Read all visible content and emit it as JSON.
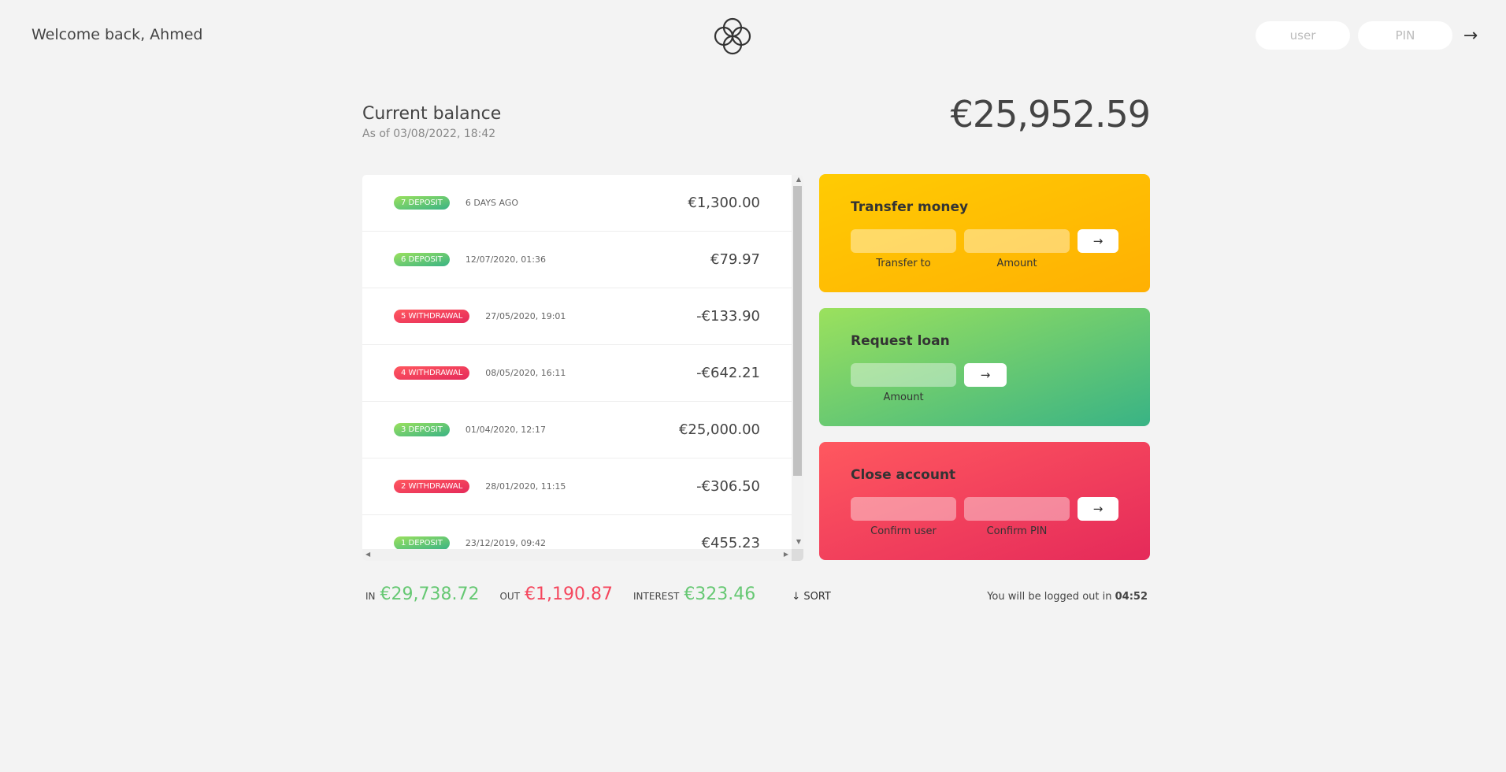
{
  "nav": {
    "welcome": "Welcome back, Ahmed",
    "user_placeholder": "user",
    "pin_placeholder": "PIN",
    "login_arrow": "→"
  },
  "balance": {
    "label": "Current balance",
    "date": "As of 03/08/2022, 18:42",
    "value": "€25,952.59"
  },
  "movements": [
    {
      "badge": "7 deposit",
      "type": "deposit",
      "date": "6 days ago",
      "value": "€1,300.00"
    },
    {
      "badge": "6 deposit",
      "type": "deposit",
      "date": "12/07/2020, 01:36",
      "value": "€79.97"
    },
    {
      "badge": "5 withdrawal",
      "type": "withdrawal",
      "date": "27/05/2020, 19:01",
      "value": "-€133.90"
    },
    {
      "badge": "4 withdrawal",
      "type": "withdrawal",
      "date": "08/05/2020, 16:11",
      "value": "-€642.21"
    },
    {
      "badge": "3 deposit",
      "type": "deposit",
      "date": "01/04/2020, 12:17",
      "value": "€25,000.00"
    },
    {
      "badge": "2 withdrawal",
      "type": "withdrawal",
      "date": "28/01/2020, 11:15",
      "value": "-€306.50"
    },
    {
      "badge": "1 deposit",
      "type": "deposit",
      "date": "23/12/2019, 09:42",
      "value": "€455.23"
    }
  ],
  "operations": {
    "transfer": {
      "title": "Transfer money",
      "label_to": "Transfer to",
      "label_amount": "Amount",
      "button": "→"
    },
    "loan": {
      "title": "Request loan",
      "label_amount": "Amount",
      "button": "→"
    },
    "close": {
      "title": "Close account",
      "label_user": "Confirm user",
      "label_pin": "Confirm PIN",
      "button": "→"
    }
  },
  "summary": {
    "in_label": "In",
    "in_value": "€29,738.72",
    "out_label": "Out",
    "out_value": "€1,190.87",
    "interest_label": "Interest",
    "interest_value": "€323.46",
    "sort": "↓ SORT"
  },
  "timer": {
    "text": "You will be logged out in",
    "time": "04:52"
  },
  "colors": {
    "deposit": "#66c873",
    "withdrawal": "#f5465d",
    "transfer": "#ffb003",
    "loan": "#39b385",
    "close": "#e52a5a"
  }
}
